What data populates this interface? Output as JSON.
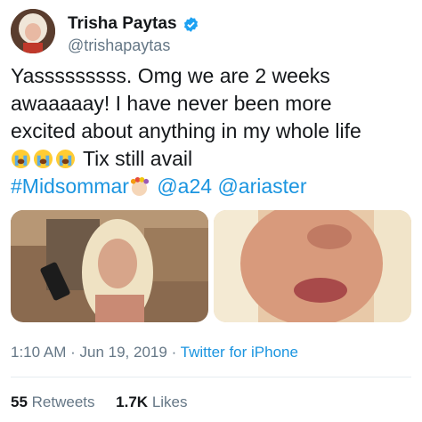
{
  "tweet": {
    "author": {
      "name": "Trisha Paytas",
      "handle": "@trishapaytas"
    },
    "text": {
      "line1": "Yasssssssss. Omg we are 2 weeks",
      "line2": "awaaaaay! I have never been more",
      "line3": "excited about anything in my whole life",
      "line4_text": "Tix still avail",
      "hashtag": "#Midsommar",
      "mention1": "@a24",
      "mention2": "@ariaster"
    },
    "emoji": {
      "crying": "loudly-crying-face-emoji",
      "flower_crown": "flower-crown-emoji"
    },
    "media": [
      {
        "icon": "selfie-with-phone-photo"
      },
      {
        "icon": "close-up-face-photo"
      }
    ],
    "timestamp": {
      "time": "1:10 AM",
      "separator": "·",
      "date": "Jun 19, 2019",
      "source": "Twitter for iPhone"
    },
    "stats": {
      "retweets_count": "55",
      "retweets_label": "Retweets",
      "likes_count": "1.7K",
      "likes_label": "Likes"
    }
  },
  "colors": {
    "link": "#1b95e0",
    "secondary_text": "#657786",
    "primary_text": "#14171a",
    "verified": "#1da1f2"
  }
}
